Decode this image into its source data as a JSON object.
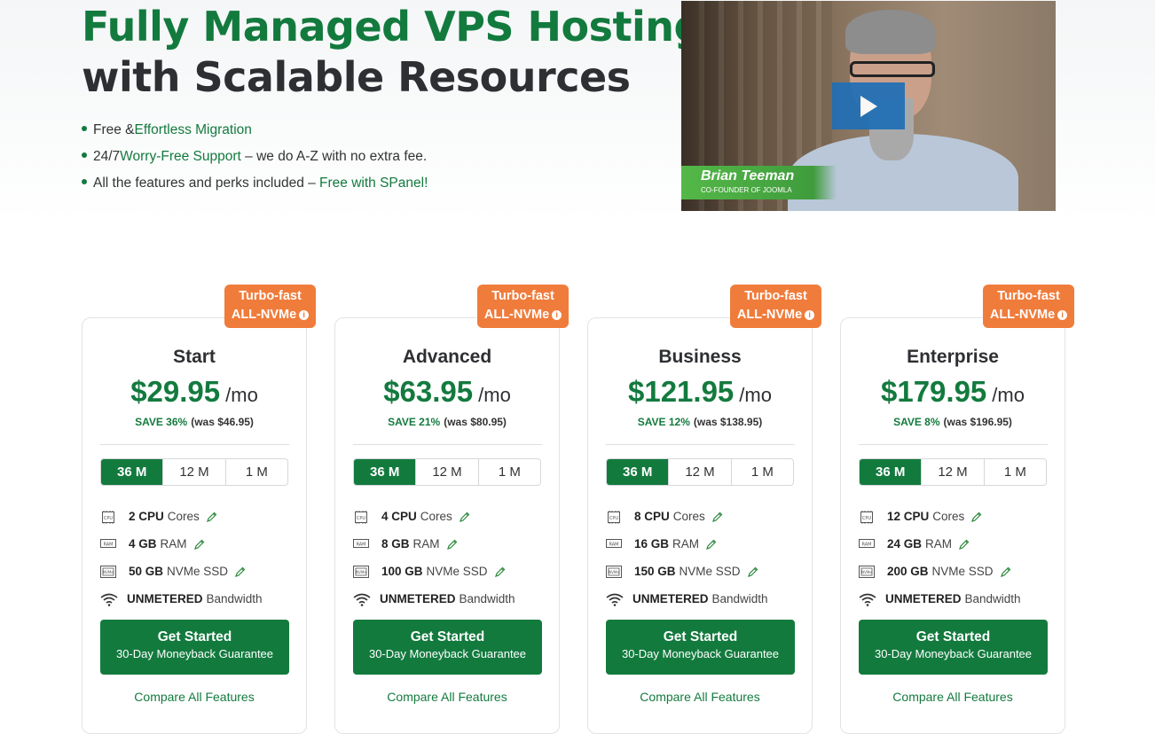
{
  "hero": {
    "title_line1": "Fully Managed VPS Hosting",
    "title_line2": "with Scalable Resources",
    "bullets": [
      {
        "pre": "Free & ",
        "link": "Effortless Migration",
        "post": ""
      },
      {
        "pre": "24/7 ",
        "link": "Worry-Free Support",
        "post": " – we do A-Z with no extra fee."
      },
      {
        "pre": "All the features and perks included – ",
        "link": "Free with SPanel!",
        "post": ""
      }
    ]
  },
  "video": {
    "person_name": "Brian Teeman",
    "person_role": "CO-FOUNDER OF JOOMLA",
    "play_icon": "play-icon"
  },
  "colors": {
    "brand_green": "#137a3e",
    "badge_orange": "#f07c3b",
    "play_blue": "#1f6fb6"
  },
  "term_options": [
    "36 M",
    "12 M",
    "1 M"
  ],
  "plans": [
    {
      "badge_line1": "Turbo-fast",
      "badge_line2": "ALL-NVMe",
      "name": "Start",
      "price": "$29.95",
      "period": "/mo",
      "save_pct": "SAVE 36%",
      "was": "(was $46.95)",
      "selected_term": "36 M",
      "cpu_val": "2 CPU",
      "cpu_label": "Cores",
      "ram_val": "4 GB",
      "ram_label": "RAM",
      "ssd_val": "50 GB",
      "ssd_label": "NVMe SSD",
      "bw_val": "UNMETERED",
      "bw_label": "Bandwidth",
      "cta": "Get Started",
      "cta_sub": "30-Day Moneyback Guarantee",
      "compare": "Compare All Features"
    },
    {
      "badge_line1": "Turbo-fast",
      "badge_line2": "ALL-NVMe",
      "name": "Advanced",
      "price": "$63.95",
      "period": "/mo",
      "save_pct": "SAVE 21%",
      "was": "(was $80.95)",
      "selected_term": "36 M",
      "cpu_val": "4 CPU",
      "cpu_label": "Cores",
      "ram_val": "8 GB",
      "ram_label": "RAM",
      "ssd_val": "100 GB",
      "ssd_label": "NVMe SSD",
      "bw_val": "UNMETERED",
      "bw_label": "Bandwidth",
      "cta": "Get Started",
      "cta_sub": "30-Day Moneyback Guarantee",
      "compare": "Compare All Features"
    },
    {
      "badge_line1": "Turbo-fast",
      "badge_line2": "ALL-NVMe",
      "name": "Business",
      "price": "$121.95",
      "period": "/mo",
      "save_pct": "SAVE 12%",
      "was": "(was $138.95)",
      "selected_term": "36 M",
      "cpu_val": "8 CPU",
      "cpu_label": "Cores",
      "ram_val": "16 GB",
      "ram_label": "RAM",
      "ssd_val": "150 GB",
      "ssd_label": "NVMe SSD",
      "bw_val": "UNMETERED",
      "bw_label": "Bandwidth",
      "cta": "Get Started",
      "cta_sub": "30-Day Moneyback Guarantee",
      "compare": "Compare All Features"
    },
    {
      "badge_line1": "Turbo-fast",
      "badge_line2": "ALL-NVMe",
      "name": "Enterprise",
      "price": "$179.95",
      "period": "/mo",
      "save_pct": "SAVE 8%",
      "was": "(was $196.95)",
      "selected_term": "36 M",
      "cpu_val": "12 CPU",
      "cpu_label": "Cores",
      "ram_val": "24 GB",
      "ram_label": "RAM",
      "ssd_val": "200 GB",
      "ssd_label": "NVMe SSD",
      "bw_val": "UNMETERED",
      "bw_label": "Bandwidth",
      "cta": "Get Started",
      "cta_sub": "30-Day Moneyback Guarantee",
      "compare": "Compare All Features"
    }
  ]
}
